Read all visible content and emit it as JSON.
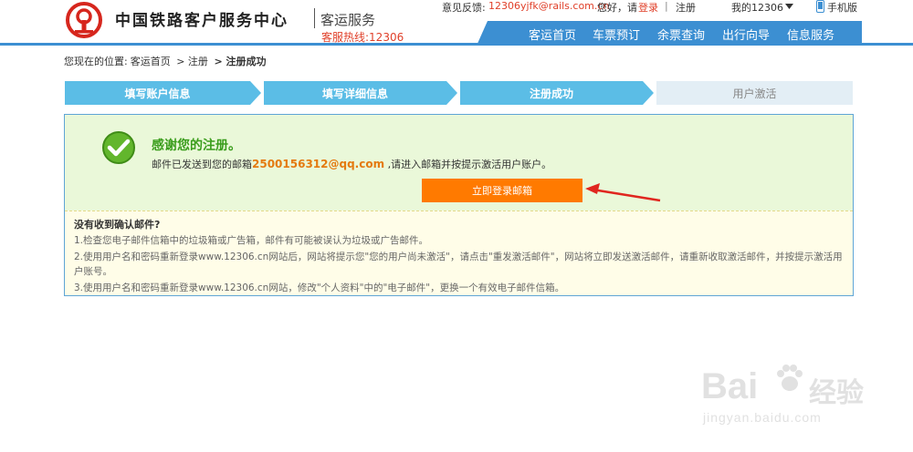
{
  "header": {
    "brand": "中国铁路客户服务中心",
    "sub": "客运服务",
    "hotline": "客服热线:12306",
    "feedback_label": "意见反馈:",
    "feedback_email": "12306yjfk@rails.com.cn",
    "greeting": "您好，请",
    "login": "登录",
    "sep": "|",
    "register": "注册",
    "my12306": "我的12306",
    "mobile": "手机版"
  },
  "nav": [
    "客运首页",
    "车票预订",
    "余票查询",
    "出行向导",
    "信息服务"
  ],
  "breadcrumb": {
    "prefix": "您现在的位置:",
    "home": "客运首页",
    "step1": "> 注册",
    "current": "> 注册成功"
  },
  "steps": [
    {
      "label": "填写账户信息",
      "status": "done"
    },
    {
      "label": "填写详细信息",
      "status": "done"
    },
    {
      "label": "注册成功",
      "status": "done"
    },
    {
      "label": "用户激活",
      "status": "todo"
    }
  ],
  "result": {
    "thanks": "感谢您的注册。",
    "sent_prefix": "邮件已发送到您的邮箱",
    "email": "2500156312@qq.com",
    "sent_suffix": " ,请进入邮箱并按提示激活用户账户。",
    "login_button": "立即登录邮箱"
  },
  "not_received": {
    "title": "没有收到确认邮件?",
    "tips": [
      "1.检查您电子邮件信箱中的垃圾箱或广告箱，邮件有可能被误认为垃圾或广告邮件。",
      "2.使用用户名和密码重新登录www.12306.cn网站后，网站将提示您\"您的用户尚未激活\"，请点击\"重发激活邮件\"，网站将立即发送激活邮件，请重新收取激活邮件，并按提示激活用户账号。",
      "3.使用用户名和密码重新登录www.12306.cn网站，修改\"个人资料\"中的\"电子邮件\"，更换一个有效电子邮件信箱。"
    ]
  },
  "watermark": {
    "brand": "Bai",
    "jingyan": "经验",
    "url": "jingyan.baidu.com"
  },
  "colors": {
    "nav_blue": "#3c8fd2",
    "step_done": "#5bbde6",
    "step_todo": "#e3eef5",
    "login_orange": "#ff7a00",
    "success_green": "#3a9d1c",
    "alert_red": "#e0402a"
  }
}
